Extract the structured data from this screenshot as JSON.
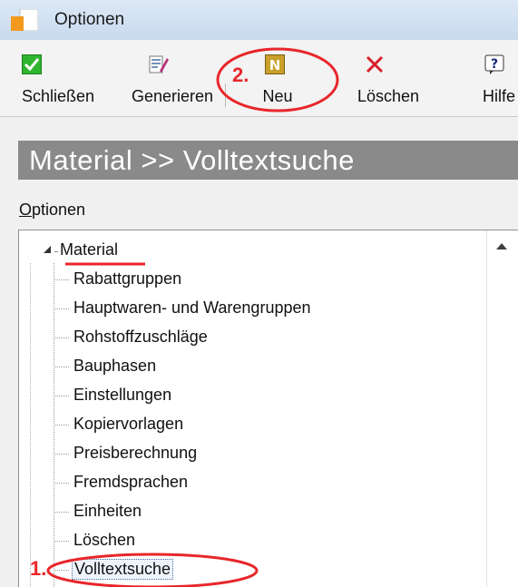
{
  "window": {
    "title": "Optionen"
  },
  "toolbar": {
    "buttons": [
      {
        "label": "Schließen",
        "icon": "check-icon"
      },
      {
        "label": "Generieren",
        "icon": "generate-icon"
      },
      {
        "label": "Neu",
        "icon": "new-icon",
        "glyph": "N"
      },
      {
        "label": "Löschen",
        "icon": "delete-x-icon"
      },
      {
        "label": "Hilfe",
        "icon": "help-icon",
        "glyph": "?"
      }
    ]
  },
  "header": {
    "title": "Material >> Volltextsuche"
  },
  "options_label": {
    "accel": "O",
    "rest": "ptionen"
  },
  "tree": {
    "root": "Material",
    "items": [
      "Rabattgruppen",
      "Hauptwaren- und Warengruppen",
      "Rohstoffzuschläge",
      "Bauphasen",
      "Einstellungen",
      "Kopiervorlagen",
      "Preisberechnung",
      "Fremdsprachen",
      "Einheiten",
      "Löschen",
      "Volltextsuche"
    ],
    "selected_index": 10
  },
  "annotations": {
    "step1": "1.",
    "step2": "2.",
    "color": "#e8262a"
  },
  "colors": {
    "header_band": "#8a8a8a",
    "check_green": "#2fb52f",
    "new_gold": "#c8a02a",
    "delete_red": "#d8202a"
  }
}
